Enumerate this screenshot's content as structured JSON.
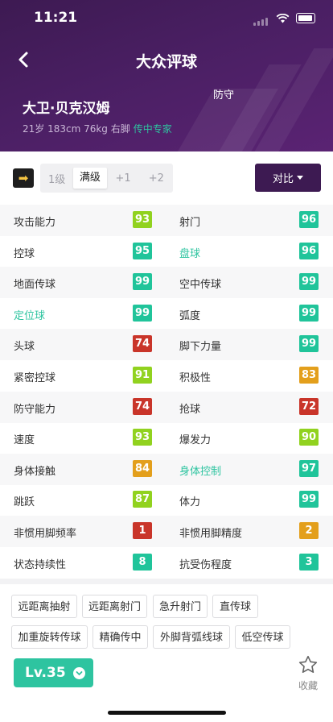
{
  "status_bar": {
    "time": "11:21"
  },
  "nav": {
    "title": "大众评球"
  },
  "player": {
    "name": "大卫·贝克汉姆",
    "info": "21岁 183cm 76kg 右脚",
    "specialty": "传中专家",
    "position": "防守"
  },
  "levels": [
    "1级",
    "满级",
    "+1",
    "+2"
  ],
  "selected_level": "满级",
  "compare_label": "对比",
  "colors": {
    "green": "#91d21f",
    "teal": "#20c49a",
    "red": "#c9352a",
    "orange": "#e39f1c",
    "brand": "#3d1a52"
  },
  "stats": [
    {
      "left": {
        "label": "攻击能力",
        "value": "93",
        "color": "green"
      },
      "right": {
        "label": "射门",
        "value": "96",
        "color": "teal"
      }
    },
    {
      "left": {
        "label": "控球",
        "value": "95",
        "color": "teal"
      },
      "right": {
        "label": "盘球",
        "value": "96",
        "color": "teal",
        "highlight": true
      }
    },
    {
      "left": {
        "label": "地面传球",
        "value": "99",
        "color": "teal"
      },
      "right": {
        "label": "空中传球",
        "value": "99",
        "color": "teal"
      }
    },
    {
      "left": {
        "label": "定位球",
        "value": "99",
        "color": "teal",
        "highlight": true
      },
      "right": {
        "label": "弧度",
        "value": "99",
        "color": "teal"
      }
    },
    {
      "left": {
        "label": "头球",
        "value": "74",
        "color": "red"
      },
      "right": {
        "label": "脚下力量",
        "value": "99",
        "color": "teal"
      }
    },
    {
      "left": {
        "label": "紧密控球",
        "value": "91",
        "color": "green"
      },
      "right": {
        "label": "积极性",
        "value": "83",
        "color": "orange"
      }
    },
    {
      "left": {
        "label": "防守能力",
        "value": "74",
        "color": "red"
      },
      "right": {
        "label": "抢球",
        "value": "72",
        "color": "red"
      }
    },
    {
      "left": {
        "label": "速度",
        "value": "93",
        "color": "green"
      },
      "right": {
        "label": "爆发力",
        "value": "90",
        "color": "green"
      }
    },
    {
      "left": {
        "label": "身体接触",
        "value": "84",
        "color": "orange"
      },
      "right": {
        "label": "身体控制",
        "value": "97",
        "color": "teal",
        "highlight": true
      }
    },
    {
      "left": {
        "label": "跳跃",
        "value": "87",
        "color": "green"
      },
      "right": {
        "label": "体力",
        "value": "99",
        "color": "teal"
      }
    },
    {
      "left": {
        "label": "非惯用脚频率",
        "value": "1",
        "color": "red"
      },
      "right": {
        "label": "非惯用脚精度",
        "value": "2",
        "color": "orange"
      }
    },
    {
      "left": {
        "label": "状态持续性",
        "value": "8",
        "color": "teal"
      },
      "right": {
        "label": "抗受伤程度",
        "value": "3",
        "color": "teal"
      }
    }
  ],
  "skills": [
    "远距离抽射",
    "远距离射门",
    "急升射门",
    "直传球",
    "加重旋转传球",
    "精确传中",
    "外脚背弧线球",
    "低空传球"
  ],
  "footer": {
    "level_badge": "Lv.35",
    "favorite_label": "收藏"
  }
}
